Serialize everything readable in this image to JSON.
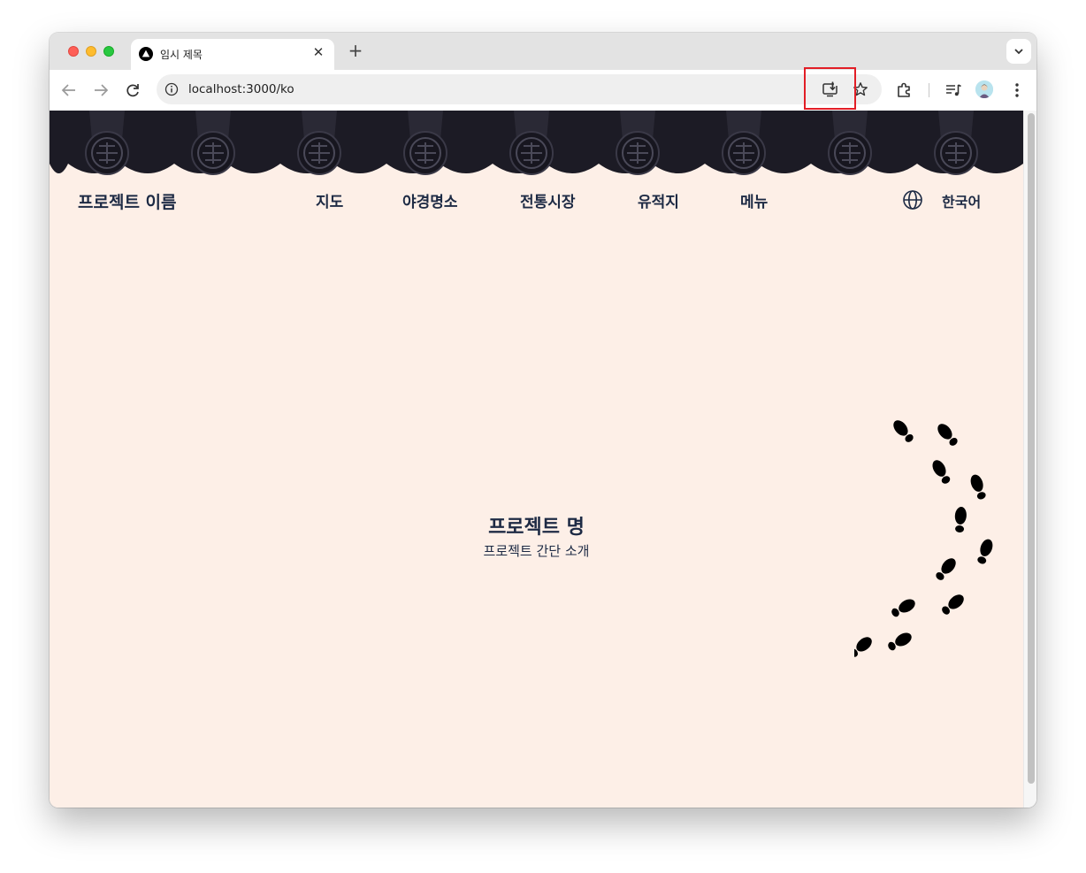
{
  "browser": {
    "tab_title": "임시 제목",
    "tab_close": "✕",
    "new_tab": "+",
    "url": "localhost:3000/ko"
  },
  "site": {
    "brand": "프로젝트 이름",
    "nav": [
      "지도",
      "야경명소",
      "전통시장",
      "유적지",
      "메뉴"
    ],
    "language": "한국어",
    "hero_title": "프로젝트 명",
    "hero_subtitle": "프로젝트 간단 소개"
  },
  "icons": {
    "back": "arrow-left-icon",
    "forward": "arrow-right-icon",
    "reload": "reload-icon",
    "site_info": "info-icon",
    "install": "install-app-icon",
    "bookmark": "star-icon",
    "extensions": "puzzle-icon",
    "media": "media-controls-icon",
    "menu": "kebab-menu-icon",
    "language": "globe-icon"
  },
  "colors": {
    "page_background": "#fdefe7",
    "text": "#1d2a44",
    "roof": "#1c1b25",
    "highlight": "#e21e26"
  }
}
